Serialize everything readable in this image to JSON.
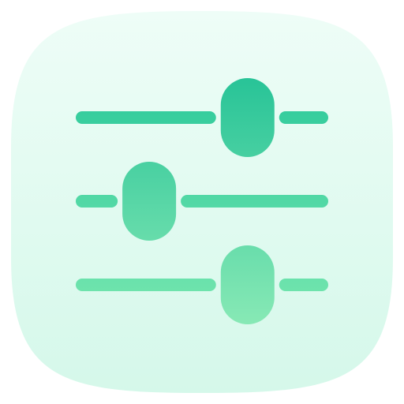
{
  "icon": {
    "name": "sliders-settings-icon",
    "colors": {
      "tile_top": "#eefdf7",
      "tile_bottom": "#d5f8ea",
      "track_top": "#2cc99b",
      "track_bottom": "#7ae8b0",
      "knob_top": "#27c397",
      "knob_bottom": "#8aeab6"
    },
    "sliders": [
      {
        "name": "slider-top",
        "level": 0.69
      },
      {
        "name": "slider-middle",
        "level": 0.28
      },
      {
        "name": "slider-bottom",
        "level": 0.69
      }
    ]
  }
}
